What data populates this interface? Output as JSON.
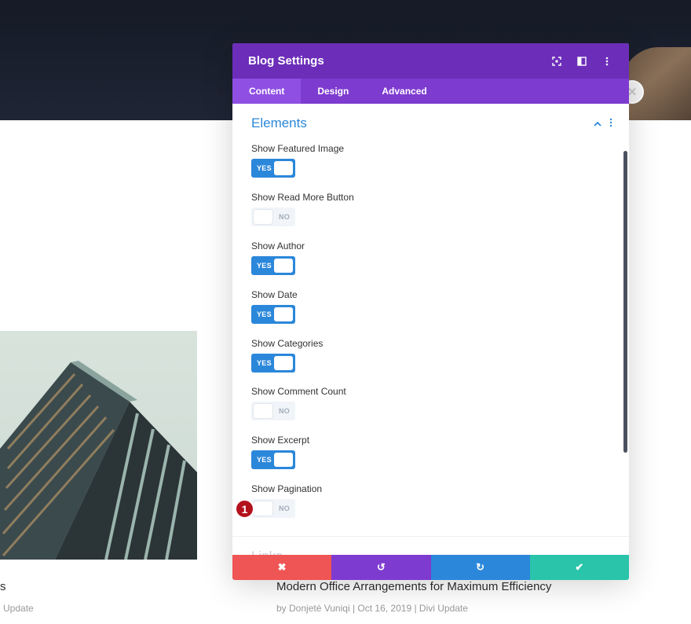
{
  "background": {
    "post_left": {
      "title": "s",
      "meta": "Update"
    },
    "post_right": {
      "title": "Modern Office Arrangements for Maximum Efficiency",
      "meta": "by Donjeté Vuniqi | Oct 16, 2019 | Divi Update"
    }
  },
  "modal": {
    "title": "Blog Settings",
    "header_icons": [
      "focus-icon",
      "split-view-icon",
      "more-vertical-icon"
    ],
    "tabs": [
      {
        "label": "Content",
        "active": true
      },
      {
        "label": "Design",
        "active": false
      },
      {
        "label": "Advanced",
        "active": false
      }
    ],
    "section": {
      "title": "Elements",
      "options": [
        {
          "label": "Show Featured Image",
          "state": "YES"
        },
        {
          "label": "Show Read More Button",
          "state": "NO"
        },
        {
          "label": "Show Author",
          "state": "YES"
        },
        {
          "label": "Show Date",
          "state": "YES"
        },
        {
          "label": "Show Categories",
          "state": "YES"
        },
        {
          "label": "Show Comment Count",
          "state": "NO"
        },
        {
          "label": "Show Excerpt",
          "state": "YES"
        },
        {
          "label": "Show Pagination",
          "state": "NO"
        }
      ]
    },
    "next_section_peek": "Links",
    "badge": "1",
    "footer": {
      "cancel": "✖",
      "undo": "↺",
      "redo": "↻",
      "save": "✔"
    }
  },
  "colors": {
    "header": "#6c2eb9",
    "tabs": "#7d3bd0",
    "accent": "#2b87da",
    "cancel": "#ef5555",
    "save": "#29c4a9"
  }
}
